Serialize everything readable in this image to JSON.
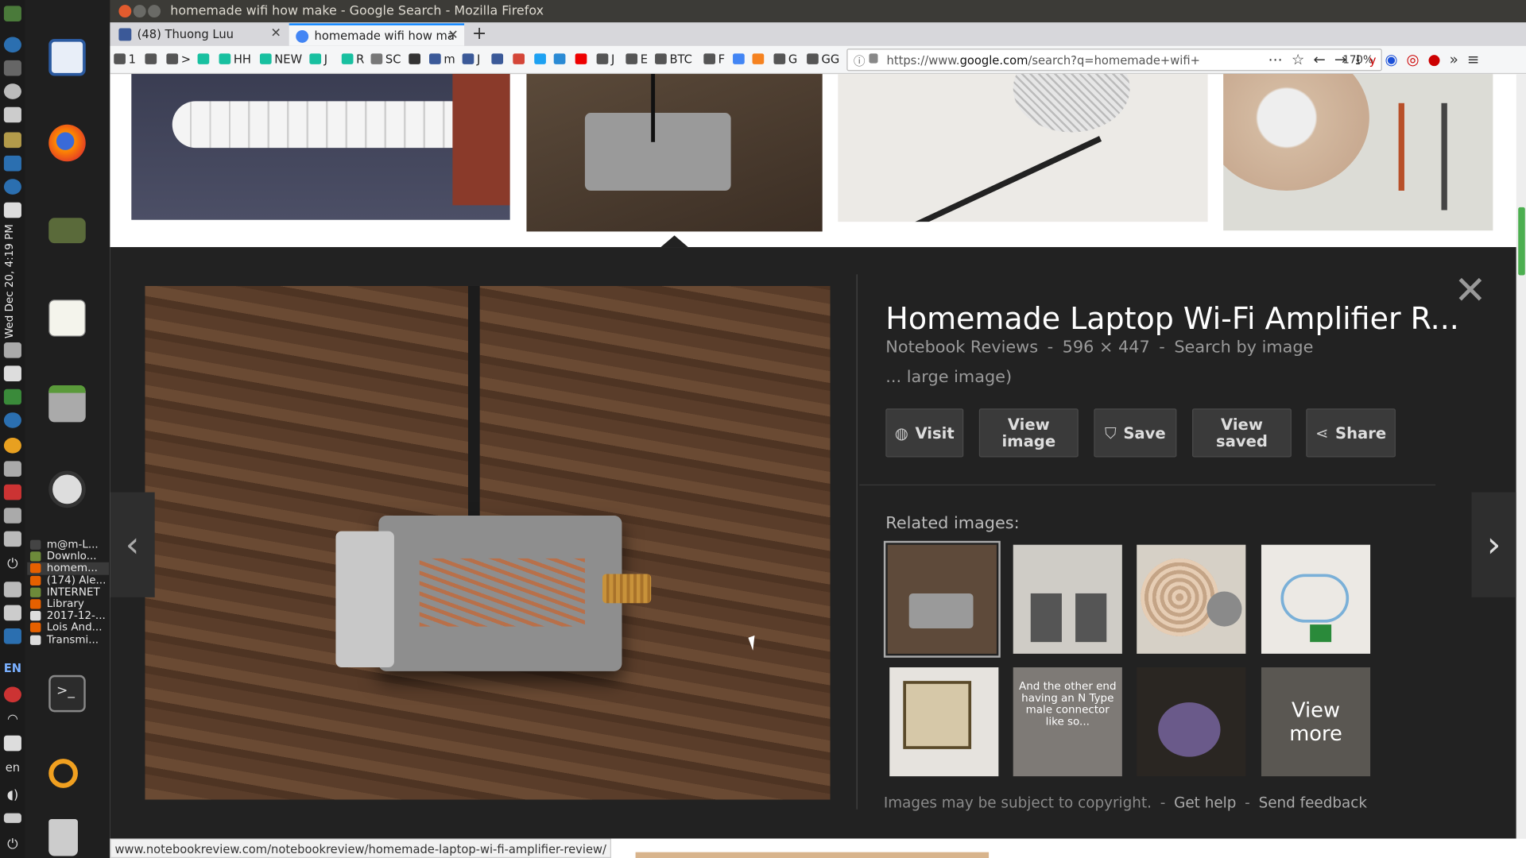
{
  "window": {
    "title": "homemade wifi how make - Google Search - Mozilla Firefox"
  },
  "sidebar": {
    "clock": "Wed Dec 20, 4:19 PM",
    "lang_upper": "EN",
    "lang_lower": "en",
    "windows": [
      {
        "label": "m@m-L...",
        "color": "#444"
      },
      {
        "label": "Downlo...",
        "color": "#6d8a3a"
      },
      {
        "label": "homem...",
        "color": "#e66000"
      },
      {
        "label": "(174) Ale...",
        "color": "#e66000"
      },
      {
        "label": "INTERNET",
        "color": "#6d8a3a"
      },
      {
        "label": "Library",
        "color": "#e66000"
      },
      {
        "label": "2017-12-...",
        "color": "#ddd"
      },
      {
        "label": "Lois And...",
        "color": "#e66000"
      },
      {
        "label": "Transmi...",
        "color": "#ddd"
      }
    ]
  },
  "tabs": [
    {
      "label": "(48) Thuong Luu",
      "icon": "facebook-icon",
      "color": "#3b5998"
    },
    {
      "label": "homemade wifi how ma",
      "icon": "google-icon",
      "color": "#4285f4"
    }
  ],
  "new_tab": "+",
  "bookmarks": [
    {
      "label": "1",
      "color": "#555"
    },
    {
      "label": "",
      "color": "#555"
    },
    {
      "label": ">",
      "color": "#555"
    },
    {
      "label": "",
      "color": "#18c0a0"
    },
    {
      "label": "HH",
      "color": "#18c0a0"
    },
    {
      "label": "NEW",
      "color": "#18c0a0"
    },
    {
      "label": "J",
      "color": "#18c0a0"
    },
    {
      "label": "R",
      "color": "#18c0a0"
    },
    {
      "label": "SC",
      "color": "#777"
    },
    {
      "label": "",
      "color": "#333"
    },
    {
      "label": "m",
      "color": "#3b5998"
    },
    {
      "label": "J",
      "color": "#3b5998"
    },
    {
      "label": "",
      "color": "#3b5998"
    },
    {
      "label": "",
      "color": "#d44638"
    },
    {
      "label": "",
      "color": "#1da1f2"
    },
    {
      "label": "",
      "color": "#2a8ad4"
    },
    {
      "label": "",
      "color": "#e00"
    },
    {
      "label": "J",
      "color": "#555"
    },
    {
      "label": "E",
      "color": "#555"
    },
    {
      "label": "BTC",
      "color": "#555"
    },
    {
      "label": "F",
      "color": "#555"
    },
    {
      "label": "",
      "color": "#4285f4"
    },
    {
      "label": "",
      "color": "#f58220"
    },
    {
      "label": "G",
      "color": "#555"
    },
    {
      "label": "GG",
      "color": "#555"
    }
  ],
  "address": {
    "url_prefix": "https://www.",
    "url_domain": "google.com",
    "url_rest": "/search?q=homemade+wifi+",
    "zoom": "170%"
  },
  "panel": {
    "title": "Homemade Laptop Wi-Fi Amplifier R...",
    "source": "Notebook Reviews",
    "dims": "596 × 447",
    "search_by_image": "Search by image",
    "separator": "-",
    "subtitle": "... large image)",
    "buttons": {
      "visit": "Visit",
      "view_image_1": "View",
      "view_image_2": "image",
      "save": "Save",
      "view_saved_1": "View",
      "view_saved_2": "saved",
      "share": "Share"
    },
    "related_label": "Related images:",
    "related_caption": "And the other end having an N Type male connector like so...",
    "view_more_1": "View",
    "view_more_2": "more",
    "footer_note": "Images may be subject to copyright.",
    "get_help": "Get help",
    "send_feedback": "Send feedback"
  },
  "status": {
    "url": "www.notebookreview.com/notebookreview/homemade-laptop-wi-fi-amplifier-review/"
  }
}
